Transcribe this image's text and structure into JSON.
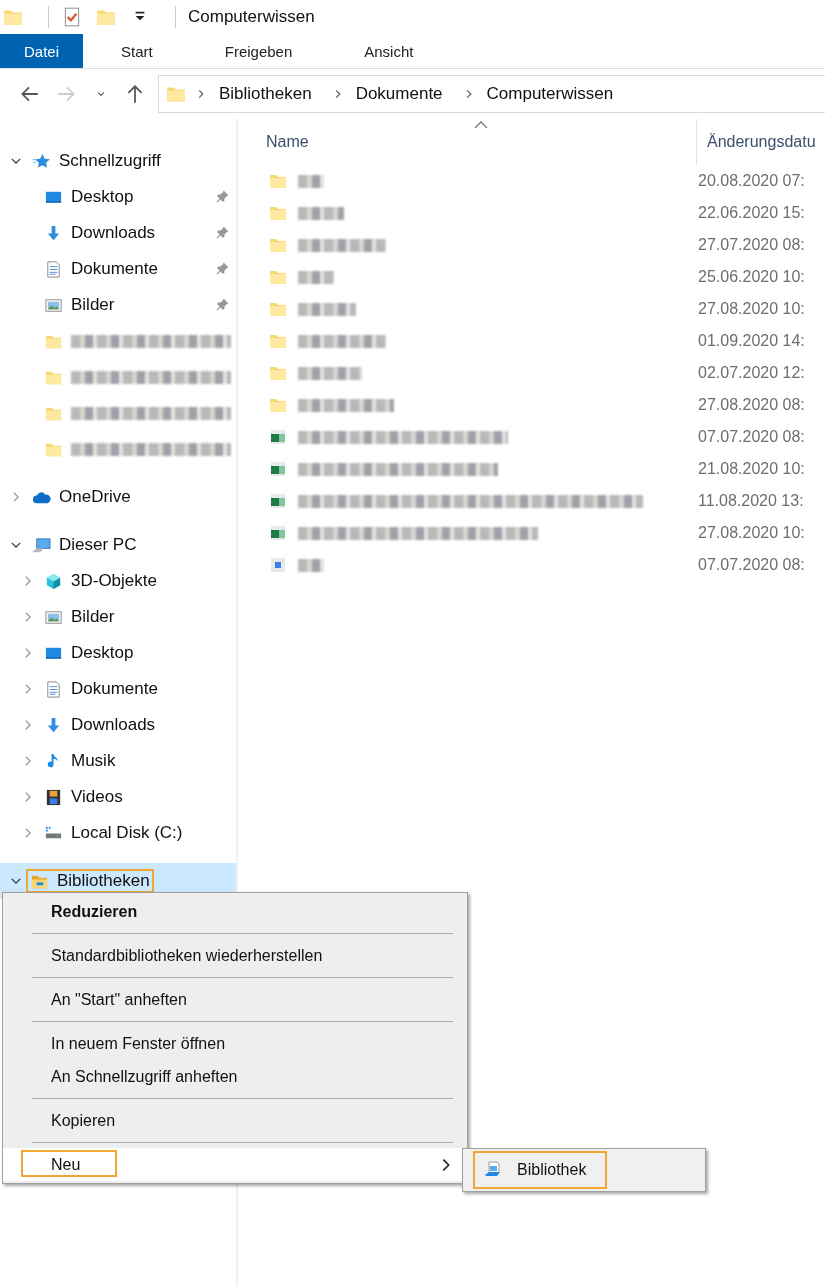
{
  "window": {
    "title": "Computerwissen"
  },
  "ribbon_tabs": [
    {
      "label": "Datei",
      "selected": true
    },
    {
      "label": "Start",
      "selected": false
    },
    {
      "label": "Freigeben",
      "selected": false
    },
    {
      "label": "Ansicht",
      "selected": false
    }
  ],
  "nav_buttons": [
    {
      "disabled": false
    },
    {
      "disabled": true
    },
    {
      "disabled": false
    },
    {
      "disabled": false
    }
  ],
  "address": {
    "path": [
      "Bibliotheken",
      "Dokumente",
      "Computerwissen"
    ]
  },
  "sidebar": {
    "items": [
      {
        "label": "Schnellzugriff",
        "kind": "star",
        "expanded": true,
        "selected": false,
        "children": [
          {
            "label": "Desktop",
            "kind": "desktop",
            "pinned": true
          },
          {
            "label": "Downloads",
            "kind": "download",
            "pinned": true
          },
          {
            "label": "Dokumente",
            "kind": "document",
            "pinned": true
          },
          {
            "label": "Bilder",
            "kind": "pictures",
            "pinned": true
          },
          {
            "kind": "blurred-folder",
            "pinned": false
          },
          {
            "kind": "blurred-folder",
            "pinned": false
          },
          {
            "kind": "blurred-folder",
            "pinned": false
          },
          {
            "kind": "blurred-folder",
            "pinned": false
          }
        ]
      },
      {
        "label": "OneDrive",
        "kind": "cloud",
        "expanded": false,
        "selected": false
      },
      {
        "label": "Dieser PC",
        "kind": "pc",
        "expanded": true,
        "selected": false,
        "children": [
          {
            "label": "3D-Objekte",
            "kind": "cube",
            "expanded": false
          },
          {
            "label": "Bilder",
            "kind": "pictures",
            "expanded": false
          },
          {
            "label": "Desktop",
            "kind": "desktop",
            "expanded": false
          },
          {
            "label": "Dokumente",
            "kind": "document",
            "expanded": false
          },
          {
            "label": "Downloads",
            "kind": "download",
            "expanded": false
          },
          {
            "label": "Musik",
            "kind": "music",
            "expanded": false
          },
          {
            "label": "Videos",
            "kind": "video",
            "expanded": false
          },
          {
            "label": "Local Disk (C:)",
            "kind": "disk",
            "expanded": false
          }
        ]
      },
      {
        "label": "Bibliotheken",
        "kind": "library-folder",
        "expanded": true,
        "selected": true,
        "highlighted": true
      }
    ]
  },
  "table": {
    "columns": [
      {
        "label": "Name",
        "sorted": true
      },
      {
        "label": "Änderungsdatu",
        "sorted": false
      }
    ],
    "rows": [
      {
        "kind": "folder",
        "modified": "20.08.2020 07:"
      },
      {
        "kind": "folder",
        "modified": "22.06.2020 15:"
      },
      {
        "kind": "folder",
        "modified": "27.07.2020 08:"
      },
      {
        "kind": "folder",
        "modified": "25.06.2020 10:"
      },
      {
        "kind": "folder",
        "modified": "27.08.2020 10:"
      },
      {
        "kind": "folder",
        "modified": "01.09.2020 14:"
      },
      {
        "kind": "folder",
        "modified": "02.07.2020 12:"
      },
      {
        "kind": "folder",
        "modified": "27.08.2020 08:"
      },
      {
        "kind": "spreadsheet",
        "modified": "07.07.2020 08:"
      },
      {
        "kind": "spreadsheet",
        "modified": "21.08.2020 10:"
      },
      {
        "kind": "spreadsheet",
        "modified": "11.08.2020 13:"
      },
      {
        "kind": "spreadsheet",
        "modified": "27.08.2020 10:"
      },
      {
        "kind": "file",
        "modified": "07.07.2020 08:"
      }
    ]
  },
  "context_menu": {
    "groups": [
      [
        {
          "label": "Reduzieren",
          "bold": true
        }
      ],
      [
        {
          "label": "Standardbibliotheken wiederherstellen"
        }
      ],
      [
        {
          "label": "An \"Start\" anheften"
        }
      ],
      [
        {
          "label": "In neuem Fenster öffnen"
        },
        {
          "label": "An Schnellzugriff anheften"
        }
      ],
      [
        {
          "label": "Kopieren"
        }
      ],
      [
        {
          "label": "Neu",
          "hovered": true,
          "highlighted": true,
          "has_submenu": true
        }
      ]
    ],
    "submenu": [
      {
        "label": "Bibliothek",
        "highlighted": true
      }
    ]
  }
}
